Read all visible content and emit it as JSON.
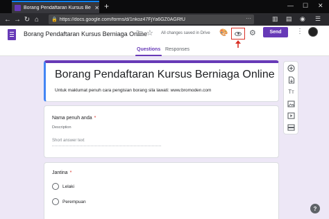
{
  "browser": {
    "tab_title": "Borang Pendaftaran Kursus Be",
    "tab_close": "✕",
    "new_tab": "+",
    "url": "https://docs.google.com/forms/d/1nkoz47FjYa6GZ0AGRfU",
    "url_more": "···",
    "window_controls": {
      "minimize": "—",
      "maximize": "☐",
      "close": "✕"
    }
  },
  "header": {
    "title": "Borang Pendaftaran Kursus Berniaga Online",
    "saved_status": "All changes saved in Drive",
    "send_label": "Send",
    "accent_color": "#673ab7",
    "highlight_color": "#d93025"
  },
  "tabs": [
    {
      "label": "Questions",
      "active": true
    },
    {
      "label": "Responses",
      "active": false
    }
  ],
  "form": {
    "title": "Borang Pendaftaran Kursus Berniaga Online",
    "description": "Untuk maklumat penuh cara pengisian borang sila lawati: www.bromoden.com"
  },
  "questions": [
    {
      "label": "Nama penuh anda",
      "required_mark": "*",
      "description": "Description",
      "answer_placeholder": "Short answer text"
    },
    {
      "label": "Jantina",
      "required_mark": "*",
      "options": [
        "Lelaki",
        "Perempuan"
      ]
    }
  ],
  "sidebar": {
    "tools": [
      "add-question",
      "import-questions",
      "add-title",
      "add-image",
      "add-video",
      "add-section"
    ],
    "title_glyph": "Tт"
  },
  "help_label": "?"
}
